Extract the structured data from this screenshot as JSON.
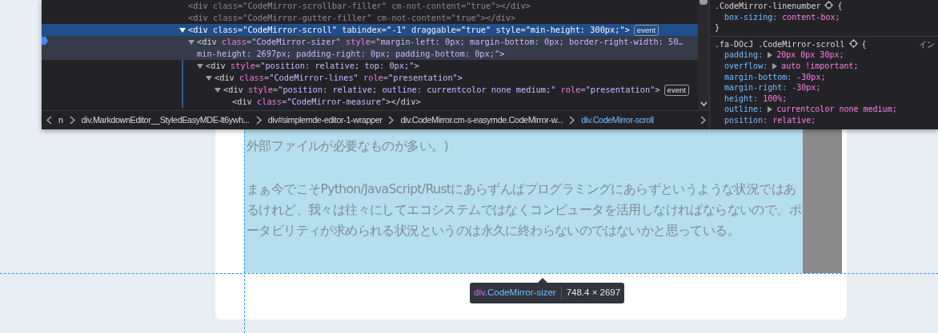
{
  "markup": {
    "nodes": [
      {
        "tokens": [
          {
            "kind": "tag",
            "text": "<div"
          },
          {
            "kind": "attr",
            "text": " class"
          },
          {
            "kind": "punct",
            "text": "="
          },
          {
            "kind": "value",
            "text": "\"CodeMirror-scrollbar-filler\""
          },
          {
            "kind": "attr",
            "text": " cm-not-content"
          },
          {
            "kind": "punct",
            "text": "="
          },
          {
            "kind": "value",
            "text": "\"true\""
          },
          {
            "kind": "tag",
            "text": "></div>"
          }
        ],
        "dimmed": true,
        "selected": false,
        "hovered": false,
        "marker": false
      },
      {
        "tokens": [
          {
            "kind": "tag",
            "text": "<div"
          },
          {
            "kind": "attr",
            "text": " class"
          },
          {
            "kind": "punct",
            "text": "="
          },
          {
            "kind": "value",
            "text": "\"CodeMirror-gutter-filler\""
          },
          {
            "kind": "attr",
            "text": " cm-not-content"
          },
          {
            "kind": "punct",
            "text": "="
          },
          {
            "kind": "value",
            "text": "\"true\""
          },
          {
            "kind": "tag",
            "text": "></div>"
          }
        ],
        "dimmed": true,
        "selected": false,
        "hovered": false,
        "marker": false
      },
      {
        "tokens": [
          {
            "kind": "tag",
            "text": "<div"
          },
          {
            "kind": "attr",
            "text": " class"
          },
          {
            "kind": "punct",
            "text": "="
          },
          {
            "kind": "value",
            "text": "\"CodeMirror-scroll\""
          },
          {
            "kind": "attr",
            "text": " tabindex"
          },
          {
            "kind": "punct",
            "text": "="
          },
          {
            "kind": "value",
            "text": "\"-1\""
          },
          {
            "kind": "attr",
            "text": " draggable"
          },
          {
            "kind": "punct",
            "text": "="
          },
          {
            "kind": "value",
            "text": "\"true\""
          },
          {
            "kind": "attr",
            "text": " style"
          },
          {
            "kind": "punct",
            "text": "="
          },
          {
            "kind": "value",
            "text": "\"min-height: 300px;\""
          },
          {
            "kind": "tag",
            "text": ">"
          }
        ],
        "badge": "event",
        "dimmed": false,
        "selected": true,
        "hovered": false,
        "marker": false,
        "expanded": true,
        "children": [
          {
            "tokens": [
              {
                "kind": "tag",
                "text": "<div"
              },
              {
                "kind": "attr",
                "text": " class"
              },
              {
                "kind": "punct",
                "text": "="
              },
              {
                "kind": "value",
                "text": "\"CodeMirror-sizer\""
              },
              {
                "kind": "attr",
                "text": " style"
              },
              {
                "kind": "punct",
                "text": "="
              },
              {
                "kind": "value",
                "text": "\"margin-left: 0px; margin-bottom: 0px; border-right-width: 50…min-height: 2697px; padding-right: 0px; padding-bottom: 0px;\""
              },
              {
                "kind": "tag",
                "text": ">"
              }
            ],
            "dimmed": false,
            "selected": false,
            "hovered": true,
            "marker": true,
            "expanded": true,
            "children": [
              {
                "tokens": [
                  {
                    "kind": "tag",
                    "text": "<div"
                  },
                  {
                    "kind": "attr",
                    "text": " style"
                  },
                  {
                    "kind": "punct",
                    "text": "="
                  },
                  {
                    "kind": "value",
                    "text": "\"position: relative; top: 0px;\""
                  },
                  {
                    "kind": "tag",
                    "text": ">"
                  }
                ],
                "dimmed": false,
                "selected": false,
                "hovered": false,
                "marker": false,
                "expanded": true,
                "children": [
                  {
                    "tokens": [
                      {
                        "kind": "tag",
                        "text": "<div"
                      },
                      {
                        "kind": "attr",
                        "text": " class"
                      },
                      {
                        "kind": "punct",
                        "text": "="
                      },
                      {
                        "kind": "value",
                        "text": "\"CodeMirror-lines\""
                      },
                      {
                        "kind": "attr",
                        "text": " role"
                      },
                      {
                        "kind": "punct",
                        "text": "="
                      },
                      {
                        "kind": "value",
                        "text": "\"presentation\""
                      },
                      {
                        "kind": "tag",
                        "text": ">"
                      }
                    ],
                    "dimmed": false,
                    "selected": false,
                    "hovered": false,
                    "marker": false,
                    "expanded": true,
                    "children": [
                      {
                        "tokens": [
                          {
                            "kind": "tag",
                            "text": "<div"
                          },
                          {
                            "kind": "attr",
                            "text": " style"
                          },
                          {
                            "kind": "punct",
                            "text": "="
                          },
                          {
                            "kind": "value",
                            "text": "\"position: relative; outline: currentcolor none medium;\""
                          },
                          {
                            "kind": "attr",
                            "text": " role"
                          },
                          {
                            "kind": "punct",
                            "text": "="
                          },
                          {
                            "kind": "value",
                            "text": "\"presentation\""
                          },
                          {
                            "kind": "tag",
                            "text": ">"
                          }
                        ],
                        "badge": "event",
                        "dimmed": false,
                        "selected": false,
                        "hovered": false,
                        "marker": false,
                        "expanded": true,
                        "children": [
                          {
                            "tokens": [
                              {
                                "kind": "tag",
                                "text": "<div"
                              },
                              {
                                "kind": "attr",
                                "text": " class"
                              },
                              {
                                "kind": "punct",
                                "text": "="
                              },
                              {
                                "kind": "value",
                                "text": "\"CodeMirror-measure\""
                              },
                              {
                                "kind": "tag",
                                "text": "></div>"
                              }
                            ],
                            "dimmed": false,
                            "selected": false,
                            "hovered": false,
                            "marker": false
                          }
                        ]
                      }
                    ]
                  }
                ]
              }
            ]
          }
        ]
      }
    ]
  },
  "breadcrumbs": [
    {
      "text": "n",
      "selected": false
    },
    {
      "text": "div.MarkdownEditor__StyledEasyMDE-lt6ywh...",
      "selected": false
    },
    {
      "text": "div#simplemde-editor-1-wrapper",
      "selected": false
    },
    {
      "text": "div.CodeMirror.cm-s-easymde.CodeMirror-w...",
      "selected": false
    },
    {
      "text": "div.CodeMirror-scroll",
      "selected": true
    }
  ],
  "styles": {
    "rules": [
      {
        "selector": ".CodeMirror-linenumber",
        "open": "{",
        "close": "}",
        "declarations": [
          {
            "property": "box-sizing:",
            "value": "content-box;",
            "expandable": false
          }
        ]
      },
      {
        "selector": ".fa-DOcJ .CodeMirror-scroll",
        "open": "{",
        "source": "イン",
        "declarations": [
          {
            "property": "padding:",
            "value": "20px 0px 30px;",
            "expandable": true
          },
          {
            "property": "overflow:",
            "value": "auto !important;",
            "expandable": true
          },
          {
            "property": "margin-bottom:",
            "value": "-30px;",
            "expandable": false
          },
          {
            "property": "margin-right:",
            "value": "-30px;",
            "expandable": false
          },
          {
            "property": "height:",
            "value": "100%;",
            "expandable": false
          },
          {
            "property": "outline:",
            "value": "currentcolor none medium;",
            "expandable": true
          },
          {
            "property": "position:",
            "value": "relative;",
            "expandable": false
          }
        ]
      }
    ]
  },
  "page": {
    "paragraphs": [
      "外部ファイルが必要なものが多い。)",
      "まぁ今でこそPython/JavaScript/Rustにあらずんばプログラミングにあらずというような状況ではあるけれど、我々は往々にしてエコシステムではなくコンピュータを活用しなければならないので、ポータビリティが求められる状況というのは永久に終わらないのではないかと思っている。"
    ]
  },
  "tooltip": {
    "tag": "div",
    "class_name": ".CodeMirror-sizer",
    "size": "748.4 × 2697"
  }
}
